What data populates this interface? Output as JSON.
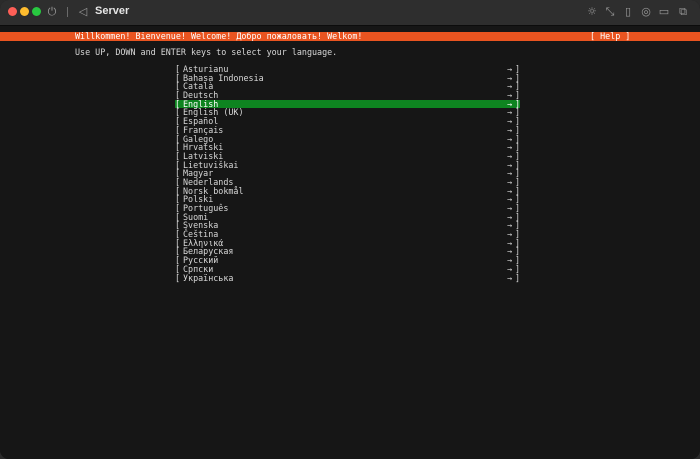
{
  "window": {
    "title": "Server",
    "toolbar_icons": [
      "power-icon",
      "pause-icon",
      "back-icon",
      "brightness-icon",
      "resize-icon",
      "usb-icon",
      "sharing-icon",
      "folder-icon",
      "windows-icon"
    ]
  },
  "installer": {
    "header_title": "Willkommen! Bienvenue! Welcome! Добро пожаловать! Welkom!",
    "help_label": "[ Help ]",
    "instruction": "Use UP, DOWN and ENTER keys to select your language.",
    "bracket_open": "[",
    "bracket_close": "]",
    "arrow": "→",
    "selected_index": 4,
    "languages": [
      {
        "label": "Asturianu"
      },
      {
        "label": "Bahasa Indonesia"
      },
      {
        "label": "Català"
      },
      {
        "label": "Deutsch"
      },
      {
        "label": "English"
      },
      {
        "label": "English (UK)"
      },
      {
        "label": "Español"
      },
      {
        "label": "Français"
      },
      {
        "label": "Galego"
      },
      {
        "label": "Hrvatski"
      },
      {
        "label": "Latviski"
      },
      {
        "label": "Lietuviškai"
      },
      {
        "label": "Magyar"
      },
      {
        "label": "Nederlands"
      },
      {
        "label": "Norsk bokmål"
      },
      {
        "label": "Polski"
      },
      {
        "label": "Português"
      },
      {
        "label": "Suomi"
      },
      {
        "label": "Svenska"
      },
      {
        "label": "Čeština"
      },
      {
        "label": "Ελληνικά"
      },
      {
        "label": "Беларуская"
      },
      {
        "label": "Русский"
      },
      {
        "label": "Српски"
      },
      {
        "label": "Українська"
      }
    ]
  }
}
